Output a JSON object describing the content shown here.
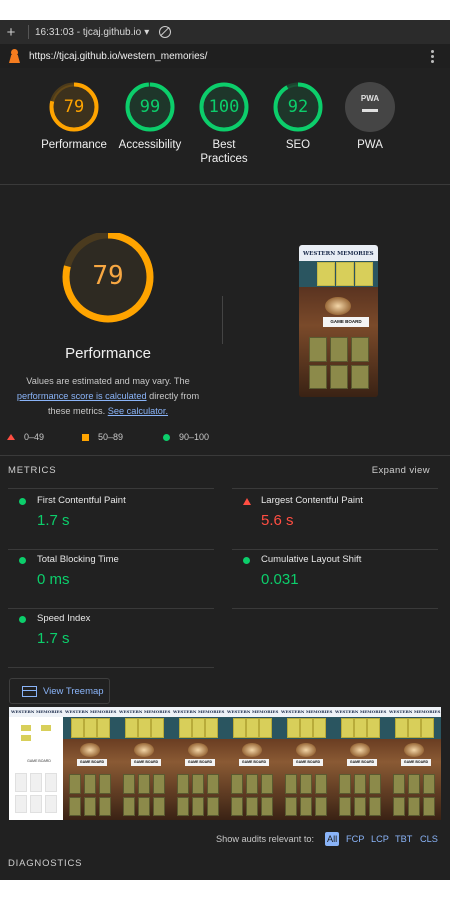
{
  "tab_bar": {
    "new_tab_glyph": "+",
    "title": "16:31:03 - tjcaj.github.io",
    "dropdown_glyph": "▾"
  },
  "address_bar": {
    "url": "https://tjcaj.github.io/western_memories/"
  },
  "colors": {
    "pass": "#0cce6b",
    "average": "#ffa400",
    "fail": "#ff4e42",
    "link": "#8ab4f8",
    "background": "#212121"
  },
  "scores": [
    {
      "value": "79",
      "label": "Performance",
      "fraction": 0.79,
      "status": "average"
    },
    {
      "value": "99",
      "label": "Accessibility",
      "fraction": 0.99,
      "status": "pass"
    },
    {
      "value": "100",
      "label": "Best Practices",
      "fraction": 1.0,
      "status": "pass"
    },
    {
      "value": "92",
      "label": "SEO",
      "fraction": 0.92,
      "status": "pass"
    },
    {
      "value": "PWA",
      "label": "PWA",
      "fraction": 0,
      "status": "na"
    }
  ],
  "performance": {
    "score": "79",
    "fraction": 0.79,
    "title": "Performance",
    "note_prefix": "Values are estimated and may vary. The",
    "note_link": "performance score is calculated",
    "note_middle": "directly from these metrics.",
    "note_calc_link": "See calculator.",
    "screenshot_heading": "WESTERN MEMORIES",
    "screenshot_board": "GAME BOARD"
  },
  "legend": [
    {
      "range": "0–49",
      "shape": "triangle"
    },
    {
      "range": "50–89",
      "shape": "square"
    },
    {
      "range": "90–100",
      "shape": "circle"
    }
  ],
  "metrics": {
    "heading": "METRICS",
    "expand_label": "Expand view",
    "items": [
      {
        "label": "First Contentful Paint",
        "value": "1.7 s",
        "status": "pass"
      },
      {
        "label": "Largest Contentful Paint",
        "value": "5.6 s",
        "status": "fail"
      },
      {
        "label": "Total Blocking Time",
        "value": "0 ms",
        "status": "pass"
      },
      {
        "label": "Cumulative Layout Shift",
        "value": "0.031",
        "status": "pass"
      },
      {
        "label": "Speed Index",
        "value": "1.7 s",
        "status": "pass"
      }
    ]
  },
  "treemap_button": "View Treemap",
  "filmstrip": {
    "frame_count": 8,
    "frame_heading": "WESTERN MEMORIES",
    "frame_board": "GAME BOARD"
  },
  "audit_filter": {
    "label": "Show audits relevant to:",
    "options": [
      "All",
      "FCP",
      "LCP",
      "TBT",
      "CLS"
    ],
    "selected": "All"
  },
  "diagnostics_heading": "DIAGNOSTICS"
}
